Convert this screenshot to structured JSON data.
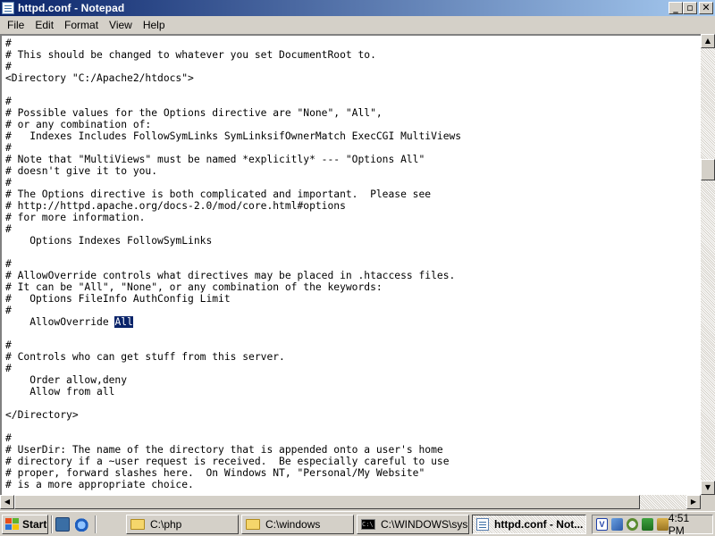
{
  "window": {
    "title": "httpd.conf - Notepad",
    "minimize_glyph": "_",
    "maximize_glyph": "▫",
    "close_glyph": "✕"
  },
  "menu": {
    "items": [
      "File",
      "Edit",
      "Format",
      "View",
      "Help"
    ]
  },
  "editor": {
    "lines": [
      "#",
      "# This should be changed to whatever you set DocumentRoot to.",
      "#",
      "<Directory \"C:/Apache2/htdocs\">",
      "",
      "#",
      "# Possible values for the Options directive are \"None\", \"All\",",
      "# or any combination of:",
      "#   Indexes Includes FollowSymLinks SymLinksifOwnerMatch ExecCGI MultiViews",
      "#",
      "# Note that \"MultiViews\" must be named *explicitly* --- \"Options All\"",
      "# doesn't give it to you.",
      "#",
      "# The Options directive is both complicated and important.  Please see",
      "# http://httpd.apache.org/docs-2.0/mod/core.html#options",
      "# for more information.",
      "#",
      "    Options Indexes FollowSymLinks",
      "",
      "#",
      "# AllowOverride controls what directives may be placed in .htaccess files.",
      "# It can be \"All\", \"None\", or any combination of the keywords:",
      "#   Options FileInfo AuthConfig Limit",
      "#",
      "    AllowOverride ",
      "",
      "#",
      "# Controls who can get stuff from this server.",
      "#",
      "    Order allow,deny",
      "    Allow from all",
      "",
      "</Directory>",
      "",
      "#",
      "# UserDir: The name of the directory that is appended onto a user's home",
      "# directory if a ~user request is received.  Be especially careful to use",
      "# proper, forward slashes here.  On Windows NT, \"Personal/My Website\"",
      "# is a more appropriate choice."
    ],
    "selected_text": "All"
  },
  "scrollbars": {
    "up": "▲",
    "down": "▼",
    "left": "◀",
    "right": "▶"
  },
  "taskbar": {
    "start_label": "Start",
    "tasks": [
      {
        "label": "C:\\php",
        "icon": "folder-icon",
        "active": false
      },
      {
        "label": "C:\\windows",
        "icon": "folder-icon",
        "active": false
      },
      {
        "label": "C:\\WINDOWS\\sys...",
        "icon": "cmd-icon",
        "active": false
      },
      {
        "label": "httpd.conf - Not...",
        "icon": "notepad-icon",
        "active": true
      }
    ],
    "clock": "4:51 PM",
    "cmd_glyph": "C:\\"
  }
}
